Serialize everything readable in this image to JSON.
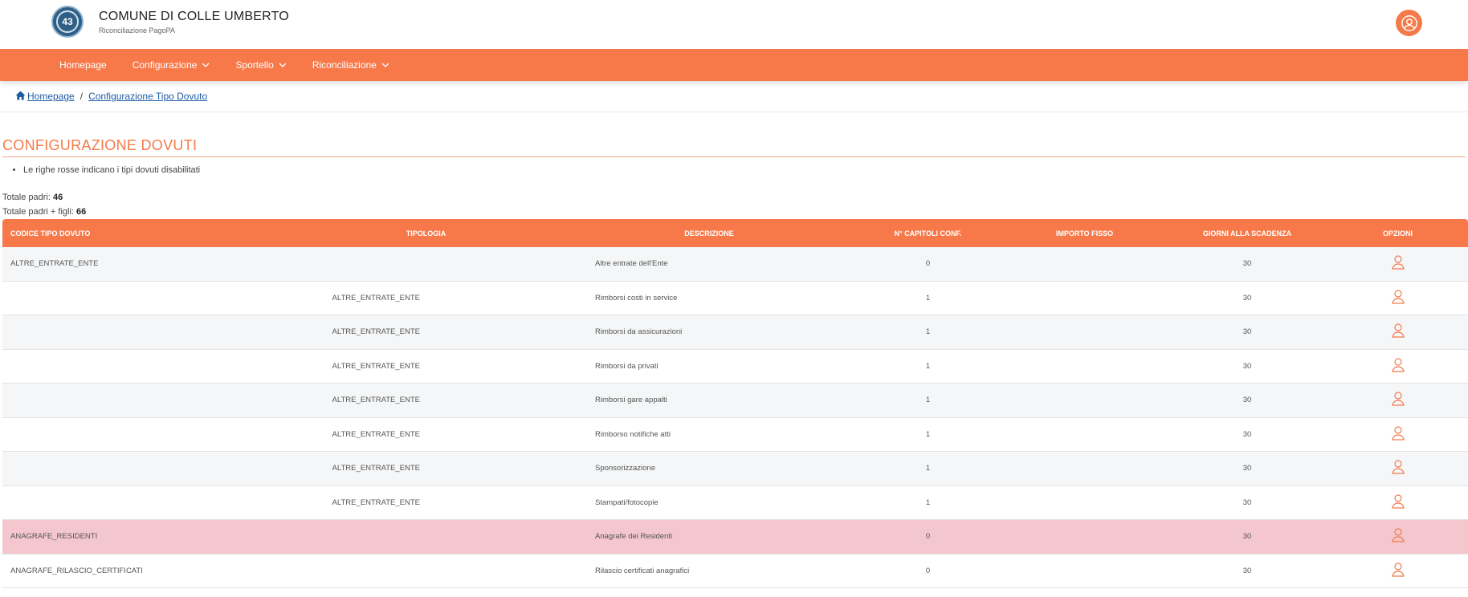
{
  "header": {
    "logo_text": "43",
    "title": "COMUNE DI COLLE UMBERTO",
    "subtitle": "Riconciliazione PagoPA",
    "user_icon": "user-circle-icon",
    "accent_color": "#f7794a"
  },
  "nav": {
    "items": [
      {
        "label": "Homepage",
        "dropdown": false
      },
      {
        "label": "Configurazione",
        "dropdown": true
      },
      {
        "label": "Sportello",
        "dropdown": true
      },
      {
        "label": "Riconciliazione",
        "dropdown": true
      }
    ]
  },
  "breadcrumb": {
    "home": "Homepage",
    "separator": "/",
    "current": "Configurazione Tipo Dovuto"
  },
  "page": {
    "title": "CONFIGURAZIONE DOVUTI",
    "note": "Le righe rosse indicano i tipi dovuti disabilitati",
    "totale_padri_label": "Totale padri:",
    "totale_padri_value": "46",
    "totale_figli_label": "Totale padri + figli:",
    "totale_figli_value": "66"
  },
  "table": {
    "columns": [
      "CODICE TIPO DOVUTO",
      "TIPOLOGIA",
      "DESCRIZIONE",
      "N° CAPITOLI CONF.",
      "IMPORTO FISSO",
      "GIORNI ALLA SCADENZA",
      "OPZIONI"
    ],
    "disabled_row_color": "#f4c6cd",
    "rows": [
      {
        "codice": "ALTRE_ENTRATE_ENTE",
        "tipologia": "",
        "descrizione": "Altre entrate dell'Ente",
        "capitoli": "0",
        "importo": "",
        "giorni": "30",
        "disabled": false
      },
      {
        "codice": "",
        "tipologia": "ALTRE_ENTRATE_ENTE",
        "descrizione": "Rimborsi costi in service",
        "capitoli": "1",
        "importo": "",
        "giorni": "30",
        "disabled": false
      },
      {
        "codice": "",
        "tipologia": "ALTRE_ENTRATE_ENTE",
        "descrizione": "Rimborsi da assicurazioni",
        "capitoli": "1",
        "importo": "",
        "giorni": "30",
        "disabled": false
      },
      {
        "codice": "",
        "tipologia": "ALTRE_ENTRATE_ENTE",
        "descrizione": "Rimborsi da privati",
        "capitoli": "1",
        "importo": "",
        "giorni": "30",
        "disabled": false
      },
      {
        "codice": "",
        "tipologia": "ALTRE_ENTRATE_ENTE",
        "descrizione": "Rimborsi gare appalti",
        "capitoli": "1",
        "importo": "",
        "giorni": "30",
        "disabled": false
      },
      {
        "codice": "",
        "tipologia": "ALTRE_ENTRATE_ENTE",
        "descrizione": "Rimborso notifiche atti",
        "capitoli": "1",
        "importo": "",
        "giorni": "30",
        "disabled": false
      },
      {
        "codice": "",
        "tipologia": "ALTRE_ENTRATE_ENTE",
        "descrizione": "Sponsorizzazione",
        "capitoli": "1",
        "importo": "",
        "giorni": "30",
        "disabled": false
      },
      {
        "codice": "",
        "tipologia": "ALTRE_ENTRATE_ENTE",
        "descrizione": "Stampati/fotocopie",
        "capitoli": "1",
        "importo": "",
        "giorni": "30",
        "disabled": false
      },
      {
        "codice": "ANAGRAFE_RESIDENTI",
        "tipologia": "",
        "descrizione": "Anagrafe dei Residenti",
        "capitoli": "0",
        "importo": "",
        "giorni": "30",
        "disabled": true
      },
      {
        "codice": "ANAGRAFE_RILASCIO_CERTIFICATI",
        "tipologia": "",
        "descrizione": "Rilascio certificati anagrafici",
        "capitoli": "0",
        "importo": "",
        "giorni": "30",
        "disabled": false
      }
    ]
  }
}
